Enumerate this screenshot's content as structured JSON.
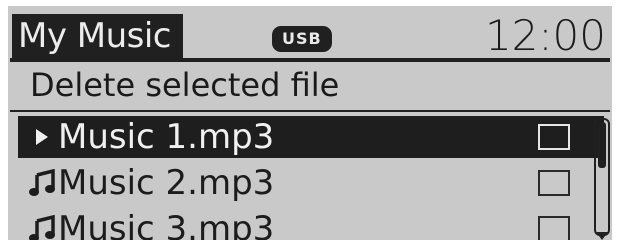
{
  "header": {
    "title": "My Music",
    "badge": "USB",
    "clock": "12:00"
  },
  "subtitle": "Delete selected file",
  "files": [
    {
      "label": "Music 1.mp3",
      "icon": "play-arrow-icon",
      "selected": true,
      "checked": false
    },
    {
      "label": "Music 2.mp3",
      "icon": "music-note-icon",
      "selected": false,
      "checked": false
    },
    {
      "label": "Music 3.mp3",
      "icon": "music-note-icon",
      "selected": false,
      "checked": false
    }
  ],
  "colors": {
    "screen_bg": "#c9c9c9",
    "ink": "#1e1e1e",
    "highlight_text": "#f0f0f0"
  }
}
